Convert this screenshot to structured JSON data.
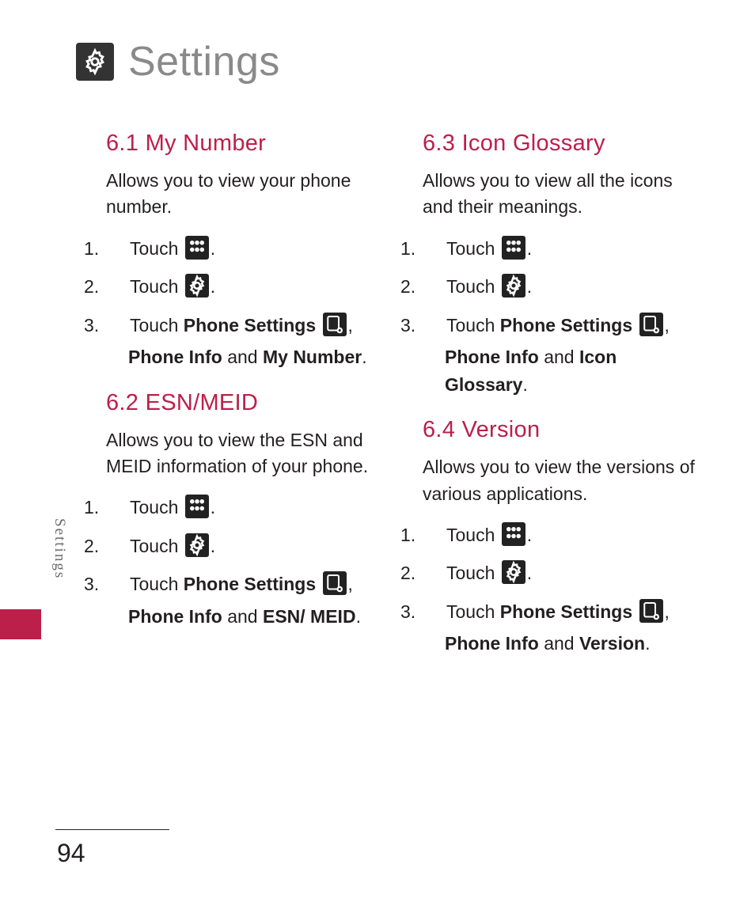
{
  "title": "Settings",
  "sideTab": "Settings",
  "pageNumber": "94",
  "common": {
    "touch": "Touch",
    "phoneSettings": "Phone Settings",
    "phoneInfo": "Phone Info",
    "and": "and",
    "period": ".",
    "comma": ","
  },
  "sections": {
    "s61": {
      "heading": "6.1 My Number",
      "desc": "Allows you to view your phone number.",
      "target": "My Number"
    },
    "s62": {
      "heading": "6.2 ESN/MEID",
      "desc": "Allows you to view the ESN and MEID information of your phone.",
      "target": "ESN/ MEID"
    },
    "s63": {
      "heading": "6.3 Icon Glossary",
      "desc": "Allows you to view all the icons and their meanings.",
      "target": "Icon Glossary"
    },
    "s64": {
      "heading": "6.4 Version",
      "desc": "Allows you to view the versions of various applications.",
      "target": "Version"
    }
  },
  "stepNums": {
    "n1": "1.",
    "n2": "2.",
    "n3": "3."
  }
}
